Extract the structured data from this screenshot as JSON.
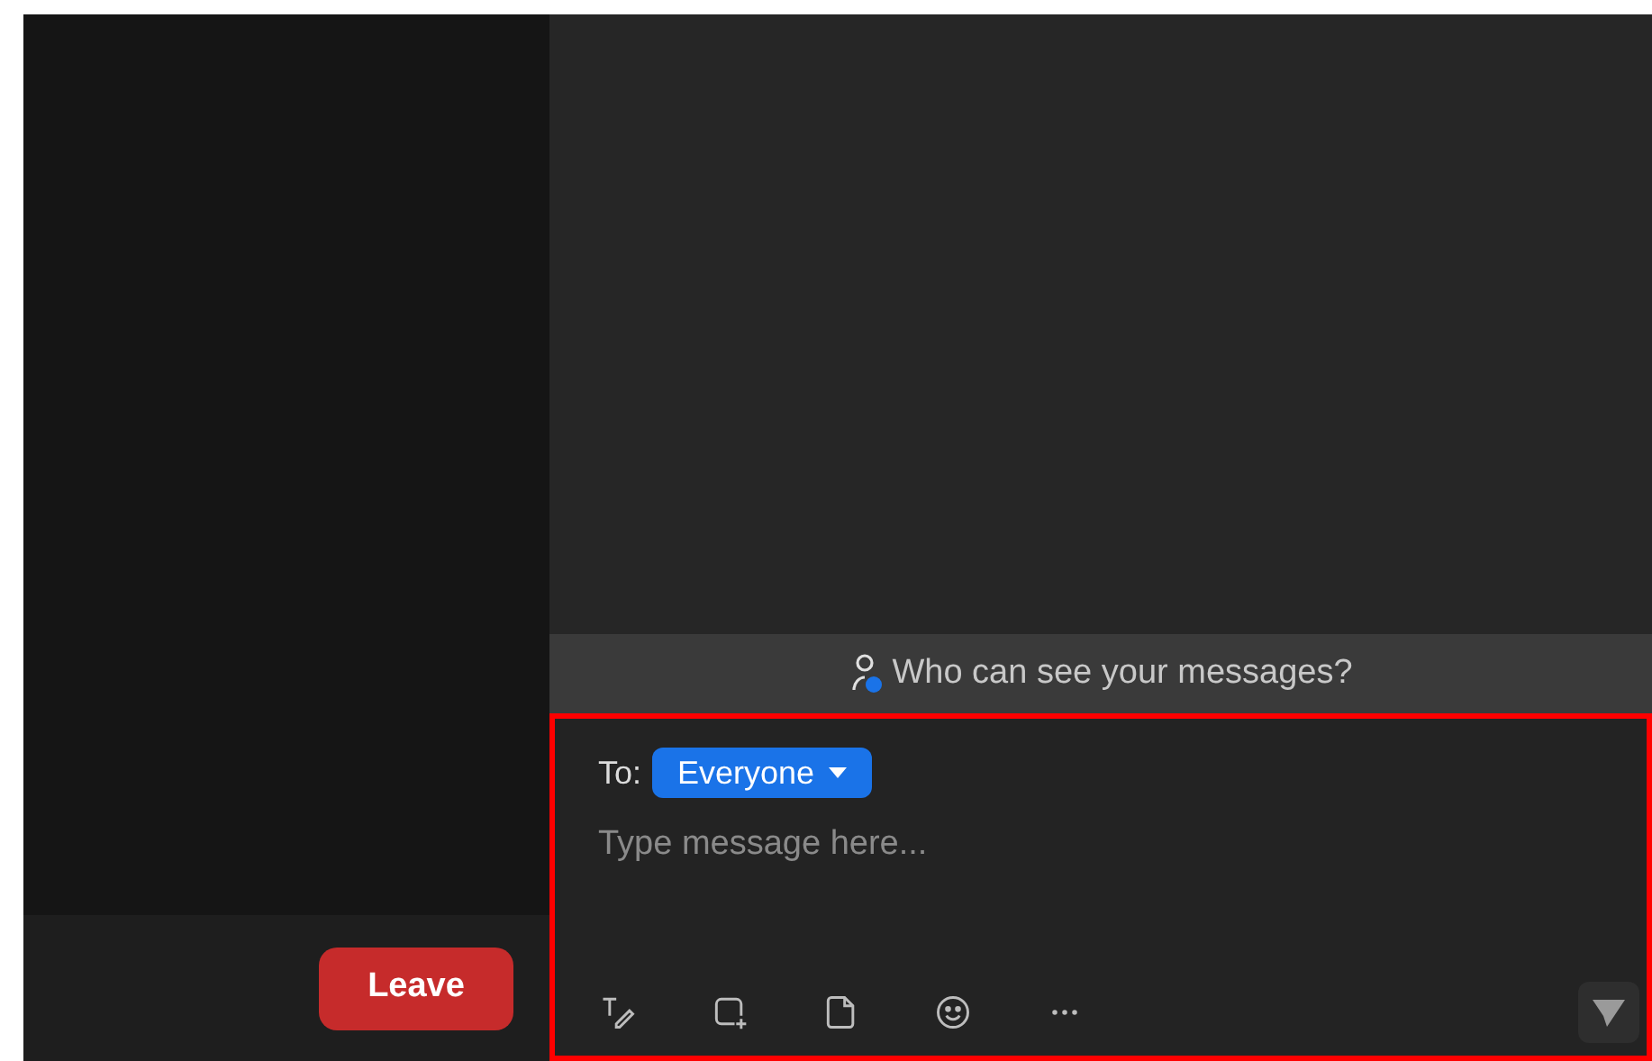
{
  "meeting": {
    "leave_button": "Leave"
  },
  "chat": {
    "notice": "Who can see your messages?",
    "recipient_label": "To:",
    "recipient": "Everyone",
    "message": {
      "placeholder": "Type message here..."
    },
    "toolbar": [
      {
        "kind": "format"
      },
      {
        "kind": "screenshot"
      },
      {
        "kind": "file"
      },
      {
        "kind": "emoji"
      },
      {
        "kind": "more"
      }
    ]
  }
}
